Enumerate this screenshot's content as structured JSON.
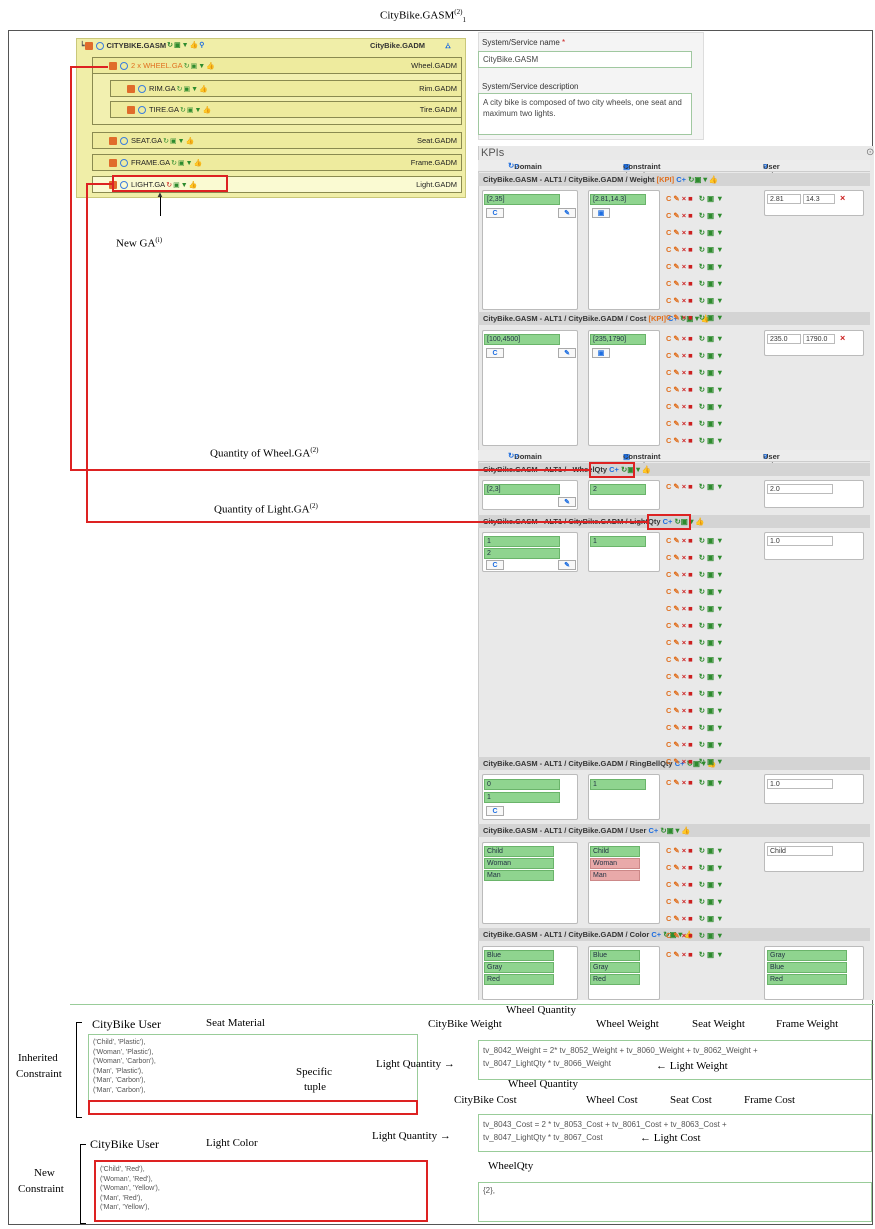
{
  "caption": "CityBike.GASM",
  "tree": {
    "root_label": "CITYBIKE.GASM",
    "root_right": "CityBike.GADM",
    "items": [
      {
        "label": "2 x WHEEL.GA",
        "right": "Wheel.GADM"
      },
      {
        "label": "RIM.GA",
        "right": "Rim.GADM"
      },
      {
        "label": "TIRE.GA",
        "right": "Tire.GADM"
      },
      {
        "label": "SEAT.GA",
        "right": "Seat.GADM"
      },
      {
        "label": "FRAME.GA",
        "right": "Frame.GADM"
      },
      {
        "label": "LIGHT.GA",
        "right": "Light.GADM"
      }
    ]
  },
  "form": {
    "name_label": "System/Service name",
    "name_value": "CityBike.GASM",
    "desc_label": "System/Service description",
    "desc_value": "A city bike is composed of two city wheels, one seat and maximum two lights."
  },
  "kpis": {
    "title": "KPIs",
    "col_domain": "Domain",
    "col_constraint": "Constraint domain",
    "col_user": "User values",
    "weight": {
      "title": "CityBike.GASM - ALT1 / CityBike.GADM / Weight",
      "domain": "[2,35]",
      "cdomain": "[2.81,14.3]",
      "u1": "2.81",
      "u2": "14.3"
    },
    "cost": {
      "title": "CityBike.GASM - ALT1 / CityBike.GADM / Cost",
      "domain": "[100,4500]",
      "cdomain": "[235,1790]",
      "u1": "235.0",
      "u2": "1790.0"
    },
    "wheel": {
      "title": "CityBike.GASM - ALT1 / ",
      "tag": "WheelQty",
      "domain": "[2,3]",
      "cdomain": "2",
      "u1": "2.0"
    },
    "light": {
      "title": "CityBike.GASM - ALT1 / CityBike.GADM / ",
      "tag": "LightQty",
      "d1": "1",
      "d2": "2",
      "cdomain": "1",
      "u1": "1.0"
    },
    "ringbell": {
      "title": "CityBike.GASM - ALT1 / CityBike.GADM / RingBellQty",
      "d1": "0",
      "d2": "1",
      "cdomain": "1",
      "u1": "1.0"
    },
    "user": {
      "title": "CityBike.GASM - ALT1 / CityBike.GADM / User",
      "d": [
        "Child",
        "Woman",
        "Man"
      ],
      "c": [
        "Child",
        "Woman",
        "Man"
      ],
      "u1": "Child"
    },
    "color": {
      "title": "CityBike.GASM - ALT1 / CityBike.GADM / Color",
      "d": [
        "Blue",
        "Gray",
        "Red"
      ],
      "c": [
        "Blue",
        "Gray",
        "Red"
      ],
      "u": [
        "Gray",
        "Blue",
        "Red"
      ]
    }
  },
  "annotations": {
    "new_ga": "New GA",
    "qty_wheel": "Quantity of Wheel.GA",
    "qty_light": "Quantity of Light.GA",
    "citybike_user_1": "CityBike User",
    "seat_material": "Seat Material",
    "inherited": "Inherited",
    "constraint": "Constraint",
    "specific_tuple_1": "Specific",
    "specific_tuple_2": "tuple",
    "citybike_user_2": "CityBike User",
    "light_color": "Light Color",
    "new": "New",
    "constraint2": "Constraint",
    "wheel_quantity_1": "Wheel Quantity",
    "citybike_weight": "CityBike Weight",
    "wheel_weight": "Wheel Weight",
    "seat_weight": "Seat Weight",
    "frame_weight": "Frame Weight",
    "light_quantity_1": "Light Quantity",
    "light_weight": "Light Weight",
    "wheel_quantity_2": "Wheel Quantity",
    "citybike_cost": "CityBike Cost",
    "wheel_cost": "Wheel Cost",
    "seat_cost": "Seat Cost",
    "frame_cost": "Frame Cost",
    "light_quantity_2": "Light Quantity",
    "light_cost": "Light Cost",
    "wheelqty": "WheelQty"
  },
  "text": {
    "inherited_tuples": [
      "('Child', 'Plastic'),",
      "('Woman', 'Plastic'),",
      "('Woman', 'Carbon'),",
      "('Man', 'Plastic'),",
      "('Man', 'Carbon'),",
      "('Man', 'Carbon'),"
    ],
    "new_tuples": [
      "('Child', 'Red'),",
      "('Woman', 'Red'),",
      "('Woman', 'Yellow'),",
      "('Man', 'Red'),",
      "('Man', 'Yellow'),"
    ],
    "weight_formula_1": "tv_8042_Weight = 2* tv_8052_Weight + tv_8060_Weight + tv_8062_Weight +",
    "weight_formula_2": "tv_8047_LightQty * tv_8066_Weight",
    "cost_formula_1": "tv_8043_Cost = 2 * tv_8053_Cost + tv_8061_Cost + tv_8063_Cost +",
    "cost_formula_2": "tv_8047_LightQty * tv_8067_Cost",
    "wheelqty_value": "{2},"
  }
}
